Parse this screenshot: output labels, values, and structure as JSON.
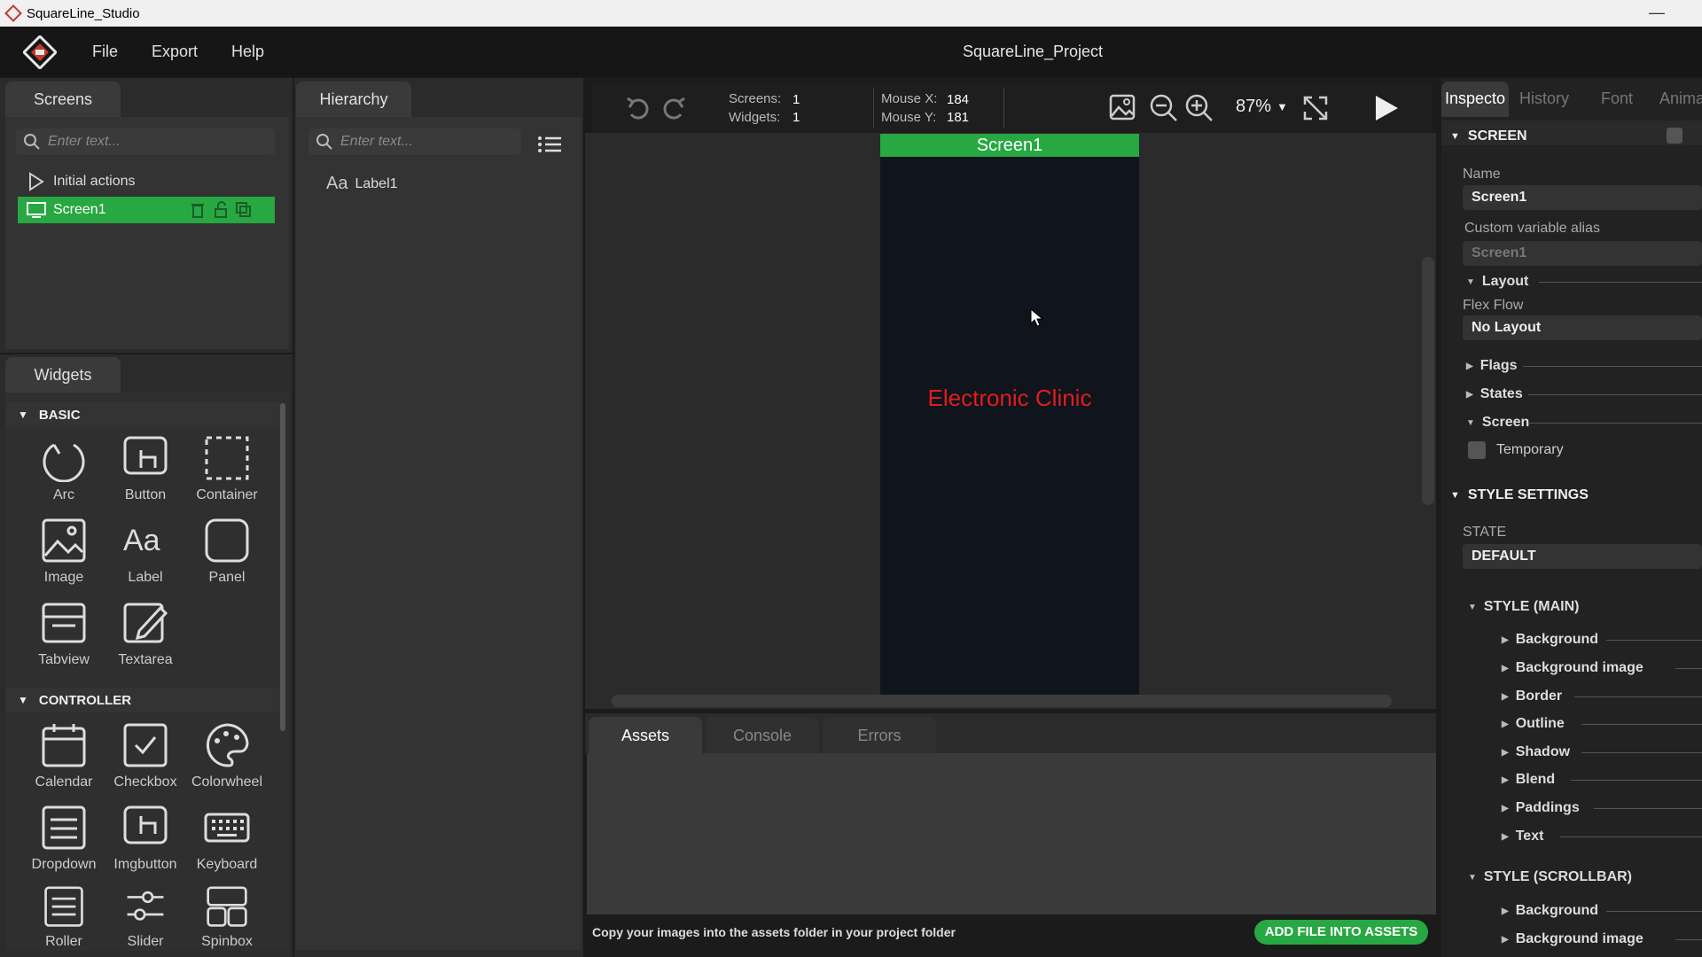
{
  "window": {
    "title": "SquareLine_Studio",
    "minimize": "—"
  },
  "menu": {
    "file": "File",
    "export": "Export",
    "help": "Help",
    "project_title": "SquareLine_Project"
  },
  "screens_panel": {
    "tab": "Screens",
    "search_placeholder": "Enter text...",
    "initial_actions": "Initial actions",
    "screen_item": "Screen1"
  },
  "hierarchy": {
    "tab": "Hierarchy",
    "search_placeholder": "Enter text...",
    "label_icon": "Aa",
    "item": "Label1"
  },
  "widgets": {
    "tab": "Widgets",
    "basic": "BASIC",
    "controller": "CONTROLLER",
    "basic_items": [
      "Arc",
      "Button",
      "Container",
      "Image",
      "Label",
      "Panel",
      "Tabview",
      "Textarea"
    ],
    "controller_items": [
      "Calendar",
      "Checkbox",
      "Colorwheel",
      "Dropdown",
      "Imgbutton",
      "Keyboard",
      "Roller",
      "Slider",
      "Spinbox"
    ]
  },
  "toolbar": {
    "screens_label": "Screens:",
    "screens_value": "1",
    "widgets_label": "Widgets:",
    "widgets_value": "1",
    "mouse_x_label": "Mouse X:",
    "mouse_x_value": "184",
    "mouse_y_label": "Mouse Y:",
    "mouse_y_value": "181",
    "zoom": "87%"
  },
  "canvas": {
    "screen_name": "Screen1",
    "label_text": "Electronic Clinic",
    "label_color": "#e21d1d"
  },
  "bottom": {
    "tabs": [
      "Assets",
      "Console",
      "Errors"
    ],
    "hint": "Copy your images into the assets folder in your project folder",
    "add_button": "ADD FILE INTO ASSETS"
  },
  "inspector": {
    "tabs": [
      "Inspecto",
      "History",
      "Font",
      "Anima"
    ],
    "screen_section": "SCREEN",
    "name_label": "Name",
    "name_value": "Screen1",
    "alias_label": "Custom variable alias",
    "alias_value": "Screen1",
    "layout": "Layout",
    "flex_flow_label": "Flex Flow",
    "flex_flow_value": "No Layout",
    "flags": "Flags",
    "states": "States",
    "screen_sub": "Screen",
    "temporary": "Temporary",
    "style_settings": "STYLE SETTINGS",
    "state_label": "STATE",
    "state_value": "DEFAULT",
    "style_main": "STYLE (MAIN)",
    "main_items": [
      "Background",
      "Background image",
      "Border",
      "Outline",
      "Shadow",
      "Blend",
      "Paddings",
      "Text"
    ],
    "style_scrollbar": "STYLE (SCROLLBAR)",
    "scrollbar_items": [
      "Background",
      "Background image"
    ],
    "accent": "#27a842"
  }
}
